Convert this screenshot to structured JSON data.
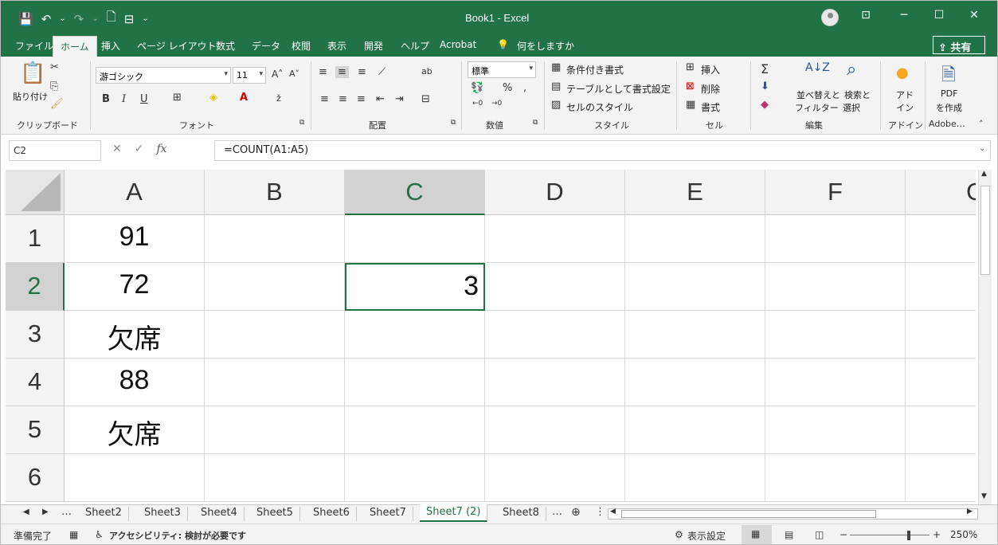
{
  "titlebar": {
    "title": "Book1  -  Excel",
    "qat": [
      "💾",
      "↶",
      "⌄",
      "↷",
      "⌄",
      "🗋",
      "⊟",
      "⌄"
    ]
  },
  "tabs": [
    "ファイル",
    "ホーム",
    "挿入",
    "ページ レイアウト",
    "数式",
    "データ",
    "校閲",
    "表示",
    "開発",
    "ヘルプ",
    "Acrobat"
  ],
  "tellme": "何をしますか",
  "share": "共有",
  "ribbon": {
    "clipboard": {
      "paste": "貼り付け",
      "label": "クリップボード"
    },
    "font": {
      "name": "游ゴシック",
      "size": "11",
      "label": "フォント"
    },
    "align": {
      "label": "配置"
    },
    "number": {
      "format": "標準",
      "label": "数値"
    },
    "styles": {
      "cond": "条件付き書式",
      "table": "テーブルとして書式設定",
      "cell": "セルのスタイル",
      "label": "スタイル"
    },
    "cells": {
      "insert": "挿入",
      "delete": "削除",
      "format": "書式",
      "label": "セル"
    },
    "editing": {
      "sort": "並べ替えと",
      "filter": "フィルター",
      "find": "検索と",
      "select": "選択",
      "label": "編集"
    },
    "addin": {
      "line1": "アド",
      "line2": "イン",
      "label": "アドイン"
    },
    "pdf": {
      "line1": "PDF",
      "line2": "を作成",
      "label": "Adobe…"
    }
  },
  "formula": {
    "namebox": "C2",
    "value": "=COUNT(A1:A5)"
  },
  "grid": {
    "columns": [
      "A",
      "B",
      "C",
      "D",
      "E",
      "F",
      "G"
    ],
    "rows": [
      "1",
      "2",
      "3",
      "4",
      "5",
      "6"
    ],
    "cells": {
      "A1": "91",
      "A2": "72",
      "A3": "欠席",
      "A4": "88",
      "A5": "欠席",
      "C2": "3"
    },
    "active_cell": "C2"
  },
  "sheets": {
    "items": [
      "Sheet2",
      "Sheet3",
      "Sheet4",
      "Sheet5",
      "Sheet6",
      "Sheet7",
      "Sheet7 (2)",
      "Sheet8"
    ],
    "active": "Sheet7 (2)"
  },
  "status": {
    "ready": "準備完了",
    "accessibility": "アクセシビリティ: 検討が必要です",
    "display": "表示設定",
    "zoom": "250%"
  }
}
